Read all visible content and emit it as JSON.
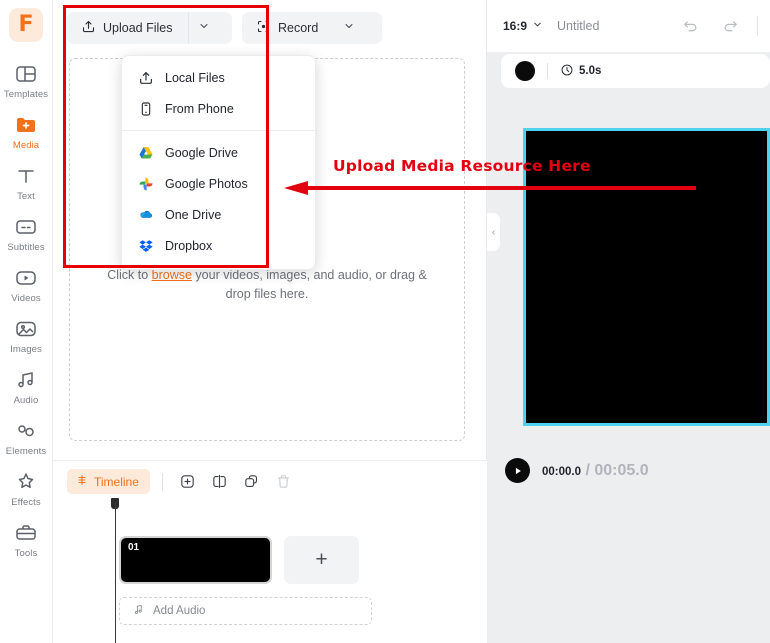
{
  "app": {
    "logo_glyph": "F",
    "accent_color": "#f2711c",
    "annotation_color": "#e3000f",
    "selection_color": "#4fd2ef"
  },
  "sidebar": {
    "items": [
      {
        "label": "Templates",
        "icon": "templates-icon",
        "active": false
      },
      {
        "label": "Media",
        "icon": "media-folder-icon",
        "active": true
      },
      {
        "label": "Text",
        "icon": "text-icon",
        "active": false
      },
      {
        "label": "Subtitles",
        "icon": "subtitles-icon",
        "active": false
      },
      {
        "label": "Videos",
        "icon": "videos-icon",
        "active": false
      },
      {
        "label": "Images",
        "icon": "images-icon",
        "active": false
      },
      {
        "label": "Audio",
        "icon": "audio-icon",
        "active": false
      },
      {
        "label": "Elements",
        "icon": "elements-icon",
        "active": false
      },
      {
        "label": "Effects",
        "icon": "effects-icon",
        "active": false
      },
      {
        "label": "Tools",
        "icon": "tools-icon",
        "active": false
      }
    ]
  },
  "media_panel": {
    "upload_button": {
      "label": "Upload Files",
      "icon": "upload-icon",
      "caret": "chevron-down-icon"
    },
    "record_button": {
      "label": "Record",
      "icon": "record-target-icon",
      "caret": "chevron-down-icon"
    },
    "dropdown": {
      "group_one": [
        {
          "label": "Local Files",
          "icon": "upload-icon"
        },
        {
          "label": "From Phone",
          "icon": "phone-icon"
        }
      ],
      "group_two": [
        {
          "label": "Google Drive",
          "icon": "google-drive-icon"
        },
        {
          "label": "Google Photos",
          "icon": "google-photos-icon"
        },
        {
          "label": "One Drive",
          "icon": "onedrive-icon"
        },
        {
          "label": "Dropbox",
          "icon": "dropbox-icon"
        }
      ]
    },
    "dropzone": {
      "text_before": "Click to ",
      "link": "browse",
      "text_after": " your videos, images, and audio, or drag & drop files here."
    }
  },
  "timeline": {
    "tab_label": "Timeline",
    "tools": [
      {
        "name": "add-clip-icon",
        "disabled": false
      },
      {
        "name": "split-clip-icon",
        "disabled": false
      },
      {
        "name": "duplicate-clip-icon",
        "disabled": false
      },
      {
        "name": "delete-clip-icon",
        "disabled": true
      }
    ],
    "clips": [
      {
        "number": "01"
      }
    ],
    "add_clip_label": "+",
    "add_audio_label": "Add Audio"
  },
  "preview": {
    "aspect_ratio": "16:9",
    "project_title": "Untitled",
    "undo_icon": "undo-icon",
    "redo_icon": "redo-icon",
    "clip_toolbar": {
      "color_swatch": "#000000",
      "duration": "5.0s",
      "clock_icon": "clock-icon"
    },
    "collapse_chevron": "‹",
    "playback": {
      "play_icon": "play-icon",
      "current_time": "00:00.0",
      "separator": " / ",
      "total_time": "00:05.0"
    }
  },
  "annotation": {
    "text": "Upload Media Resource Here"
  }
}
